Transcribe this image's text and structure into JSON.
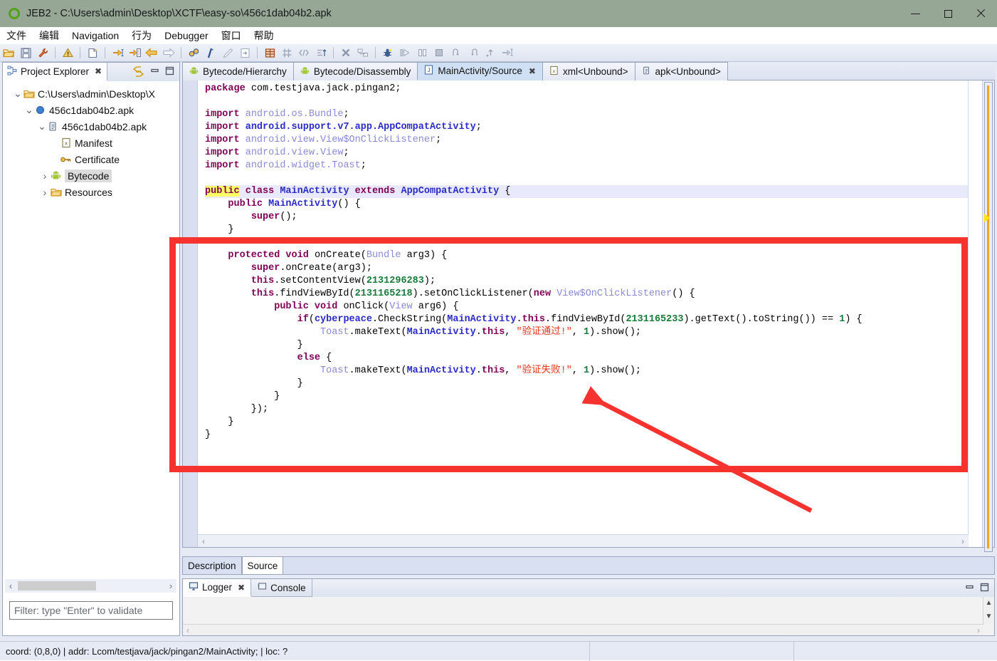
{
  "window": {
    "title": "JEB2 - C:\\Users\\admin\\Desktop\\XCTF\\easy-so\\456c1dab04b2.apk",
    "app_icon": "jeb-circle-icon",
    "minimize": "—",
    "maximize": "□",
    "close": "✕"
  },
  "menubar": {
    "items": [
      {
        "label": "文件"
      },
      {
        "label": "编辑"
      },
      {
        "label": "Navigation"
      },
      {
        "label": "行为"
      },
      {
        "label": "Debugger"
      },
      {
        "label": "窗口"
      },
      {
        "label": "帮助"
      }
    ]
  },
  "toolbar": {
    "groups": [
      [
        "open-folder-icon",
        "save-icon",
        "wrench-icon"
      ],
      [
        "warning-icon"
      ],
      [
        "new-document-icon"
      ],
      [
        "step-into-icon",
        "step-over-icon",
        "back-arrow-icon",
        "forward-arrow-icon"
      ],
      [
        "gears-icon",
        "comment-icon",
        "pencil-icon",
        "export-icon"
      ],
      [
        "table-icon",
        "grid-icon",
        "code-brackets-icon",
        "sort-icon"
      ],
      [
        "stop-icon",
        "disconnect-icon"
      ],
      [
        "debug-bug-icon",
        "resume-icon",
        "pause-icon",
        "terminate-icon",
        "step-return-icon",
        "step-back-icon",
        "step-out-icon",
        "run-to-line-icon"
      ]
    ]
  },
  "project_explorer": {
    "tab_label": "Project Explorer",
    "tab_icon": "project-explorer-icon",
    "close_icon": "✖",
    "tools": [
      "link-arrows-icon",
      "minimize-icon",
      "maximize-icon"
    ],
    "tree": [
      {
        "label": "C:\\Users\\admin\\Desktop\\X",
        "icon": "folder-icon",
        "twisty": "⌄",
        "depth": 0,
        "selected": false
      },
      {
        "label": "456c1dab04b2.apk",
        "icon": "blue-circle-icon",
        "twisty": "⌄",
        "depth": 1,
        "selected": false
      },
      {
        "label": "456c1dab04b2.apk",
        "icon": "apk-icon",
        "twisty": "⌄",
        "depth": 2,
        "selected": false
      },
      {
        "label": "Manifest",
        "icon": "xml-icon",
        "twisty": "",
        "depth": 3,
        "selected": false
      },
      {
        "label": "Certificate",
        "icon": "key-icon",
        "twisty": "",
        "depth": 3,
        "selected": false
      },
      {
        "label": "Bytecode",
        "icon": "android-icon",
        "twisty": "›",
        "depth": 3,
        "selected": true
      },
      {
        "label": "Resources",
        "icon": "folder-icon",
        "twisty": "›",
        "depth": 3,
        "selected": false
      }
    ],
    "hscroll": {
      "left_arrow": "‹",
      "right_arrow": "›"
    },
    "filter_placeholder": "Filter: type \"Enter\" to validate",
    "filter_value": ""
  },
  "editor": {
    "tabs": [
      {
        "label": "Bytecode/Hierarchy",
        "icon": "android-icon",
        "active": false,
        "closable": false
      },
      {
        "label": "Bytecode/Disassembly",
        "icon": "android-icon",
        "active": false,
        "closable": false
      },
      {
        "label": "MainActivity/Source",
        "icon": "java-icon",
        "active": true,
        "closable": true,
        "close_icon": "✖"
      },
      {
        "label": "xml<Unbound>",
        "icon": "xml-icon",
        "active": false,
        "closable": false
      },
      {
        "label": "apk<Unbound>",
        "icon": "apk-icon",
        "active": false,
        "closable": false
      }
    ],
    "bottom_tabs": [
      {
        "label": "Description",
        "active": false
      },
      {
        "label": "Source",
        "active": true
      }
    ],
    "hscroll": {
      "left_arrow": "‹",
      "right_arrow": "›"
    },
    "code_lines": [
      {
        "highlight": false,
        "tokens": [
          {
            "t": "package ",
            "c": "kw"
          },
          {
            "t": "com.testjava.jack.pingan2;",
            "c": "plain"
          }
        ]
      },
      {
        "highlight": false,
        "tokens": []
      },
      {
        "highlight": false,
        "tokens": [
          {
            "t": "import ",
            "c": "kw"
          },
          {
            "t": "android.os.Bundle",
            "c": "idl"
          },
          {
            "t": ";",
            "c": "plain"
          }
        ]
      },
      {
        "highlight": false,
        "tokens": [
          {
            "t": "import ",
            "c": "kw"
          },
          {
            "t": "android.support.v7.app.AppCompatActivity",
            "c": "typ"
          },
          {
            "t": ";",
            "c": "plain"
          }
        ]
      },
      {
        "highlight": false,
        "tokens": [
          {
            "t": "import ",
            "c": "kw"
          },
          {
            "t": "android.view.View$OnClickListener",
            "c": "idl"
          },
          {
            "t": ";",
            "c": "plain"
          }
        ]
      },
      {
        "highlight": false,
        "tokens": [
          {
            "t": "import ",
            "c": "kw"
          },
          {
            "t": "android.view.View",
            "c": "idl"
          },
          {
            "t": ";",
            "c": "plain"
          }
        ]
      },
      {
        "highlight": false,
        "tokens": [
          {
            "t": "import ",
            "c": "kw"
          },
          {
            "t": "android.widget.Toast",
            "c": "idl"
          },
          {
            "t": ";",
            "c": "plain"
          }
        ]
      },
      {
        "highlight": false,
        "tokens": []
      },
      {
        "highlight": true,
        "tokens": [
          {
            "t": "public",
            "c": "kw2"
          },
          {
            "t": " ",
            "c": "plain"
          },
          {
            "t": "class ",
            "c": "kw"
          },
          {
            "t": "MainActivity",
            "c": "typ"
          },
          {
            "t": " ",
            "c": "plain"
          },
          {
            "t": "extends ",
            "c": "kw"
          },
          {
            "t": "AppCompatActivity",
            "c": "typ"
          },
          {
            "t": " {",
            "c": "plain"
          }
        ]
      },
      {
        "highlight": false,
        "tokens": [
          {
            "t": "    ",
            "c": "plain"
          },
          {
            "t": "public ",
            "c": "kw"
          },
          {
            "t": "MainActivity",
            "c": "typ"
          },
          {
            "t": "() {",
            "c": "plain"
          }
        ]
      },
      {
        "highlight": false,
        "tokens": [
          {
            "t": "        ",
            "c": "plain"
          },
          {
            "t": "super",
            "c": "kw"
          },
          {
            "t": "();",
            "c": "plain"
          }
        ]
      },
      {
        "highlight": false,
        "tokens": [
          {
            "t": "    }",
            "c": "plain"
          }
        ]
      },
      {
        "highlight": false,
        "tokens": []
      },
      {
        "highlight": false,
        "tokens": [
          {
            "t": "    ",
            "c": "plain"
          },
          {
            "t": "protected void ",
            "c": "kw"
          },
          {
            "t": "onCreate(",
            "c": "plain"
          },
          {
            "t": "Bundle",
            "c": "idl"
          },
          {
            "t": " arg3) {",
            "c": "plain"
          }
        ]
      },
      {
        "highlight": false,
        "tokens": [
          {
            "t": "        ",
            "c": "plain"
          },
          {
            "t": "super",
            "c": "kw"
          },
          {
            "t": ".onCreate(arg3);",
            "c": "plain"
          }
        ]
      },
      {
        "highlight": false,
        "tokens": [
          {
            "t": "        ",
            "c": "plain"
          },
          {
            "t": "this",
            "c": "kw"
          },
          {
            "t": ".setContentView(",
            "c": "plain"
          },
          {
            "t": "2131296283",
            "c": "num"
          },
          {
            "t": ");",
            "c": "plain"
          }
        ]
      },
      {
        "highlight": false,
        "tokens": [
          {
            "t": "        ",
            "c": "plain"
          },
          {
            "t": "this",
            "c": "kw"
          },
          {
            "t": ".findViewById(",
            "c": "plain"
          },
          {
            "t": "2131165218",
            "c": "num"
          },
          {
            "t": ").setOnClickListener(",
            "c": "plain"
          },
          {
            "t": "new ",
            "c": "kw"
          },
          {
            "t": "View$OnClickListener",
            "c": "idl"
          },
          {
            "t": "() {",
            "c": "plain"
          }
        ]
      },
      {
        "highlight": false,
        "tokens": [
          {
            "t": "            ",
            "c": "plain"
          },
          {
            "t": "public void ",
            "c": "kw"
          },
          {
            "t": "onClick(",
            "c": "plain"
          },
          {
            "t": "View",
            "c": "idl"
          },
          {
            "t": " arg6) {",
            "c": "plain"
          }
        ]
      },
      {
        "highlight": false,
        "tokens": [
          {
            "t": "                ",
            "c": "plain"
          },
          {
            "t": "if",
            "c": "kw"
          },
          {
            "t": "(",
            "c": "plain"
          },
          {
            "t": "cyberpeace",
            "c": "typ"
          },
          {
            "t": ".CheckString(",
            "c": "plain"
          },
          {
            "t": "MainActivity",
            "c": "typ"
          },
          {
            "t": ".",
            "c": "plain"
          },
          {
            "t": "this",
            "c": "kw"
          },
          {
            "t": ".findViewById(",
            "c": "plain"
          },
          {
            "t": "2131165233",
            "c": "num"
          },
          {
            "t": ").getText().toString()) == ",
            "c": "plain"
          },
          {
            "t": "1",
            "c": "num"
          },
          {
            "t": ") {",
            "c": "plain"
          }
        ]
      },
      {
        "highlight": false,
        "tokens": [
          {
            "t": "                    ",
            "c": "plain"
          },
          {
            "t": "Toast",
            "c": "idl"
          },
          {
            "t": ".makeText(",
            "c": "plain"
          },
          {
            "t": "MainActivity",
            "c": "typ"
          },
          {
            "t": ".",
            "c": "plain"
          },
          {
            "t": "this",
            "c": "kw"
          },
          {
            "t": ", ",
            "c": "plain"
          },
          {
            "t": "\"验证通过!\"",
            "c": "str"
          },
          {
            "t": ", ",
            "c": "plain"
          },
          {
            "t": "1",
            "c": "num"
          },
          {
            "t": ").show();",
            "c": "plain"
          }
        ]
      },
      {
        "highlight": false,
        "tokens": [
          {
            "t": "                }",
            "c": "plain"
          }
        ]
      },
      {
        "highlight": false,
        "tokens": [
          {
            "t": "                ",
            "c": "plain"
          },
          {
            "t": "else",
            "c": "kw"
          },
          {
            "t": " {",
            "c": "plain"
          }
        ]
      },
      {
        "highlight": false,
        "tokens": [
          {
            "t": "                    ",
            "c": "plain"
          },
          {
            "t": "Toast",
            "c": "idl"
          },
          {
            "t": ".makeText(",
            "c": "plain"
          },
          {
            "t": "MainActivity",
            "c": "typ"
          },
          {
            "t": ".",
            "c": "plain"
          },
          {
            "t": "this",
            "c": "kw"
          },
          {
            "t": ", ",
            "c": "plain"
          },
          {
            "t": "\"验证失败!\"",
            "c": "str"
          },
          {
            "t": ", ",
            "c": "plain"
          },
          {
            "t": "1",
            "c": "num"
          },
          {
            "t": ").show();",
            "c": "plain"
          }
        ]
      },
      {
        "highlight": false,
        "tokens": [
          {
            "t": "                }",
            "c": "plain"
          }
        ]
      },
      {
        "highlight": false,
        "tokens": [
          {
            "t": "            }",
            "c": "plain"
          }
        ]
      },
      {
        "highlight": false,
        "tokens": [
          {
            "t": "        });",
            "c": "plain"
          }
        ]
      },
      {
        "highlight": false,
        "tokens": [
          {
            "t": "    }",
            "c": "plain"
          }
        ]
      },
      {
        "highlight": false,
        "tokens": [
          {
            "t": "}",
            "c": "plain"
          }
        ]
      }
    ]
  },
  "logger": {
    "tabs": [
      {
        "label": "Logger",
        "icon": "logger-icon",
        "active": true,
        "closable": true,
        "close_icon": "✖"
      },
      {
        "label": "Console",
        "icon": "console-icon",
        "active": false,
        "closable": false
      }
    ],
    "tools": [
      "minimize-icon",
      "maximize-icon"
    ],
    "scroll_up": "▲",
    "scroll_down": "▼",
    "hscroll_left": "‹",
    "hscroll_right": "›",
    "content": ""
  },
  "statusbar": {
    "text": "coord: (0,8,0) | addr: Lcom/testjava/jack/pingan2/MainActivity; | loc: ?"
  },
  "annotations": {
    "highlight_rect_color": "#f6332e",
    "arrow_color": "#f6332e",
    "arrow_label": "points-to-verification-failed-toast"
  },
  "colors": {
    "titlebar": "#97a795",
    "accent_tab": "#cfe0f5",
    "panel": "#e6eaf5",
    "scroll_marker_orange": "#f5a020",
    "marker_green": "#44dd22",
    "marker_yellow": "#ffe500"
  }
}
